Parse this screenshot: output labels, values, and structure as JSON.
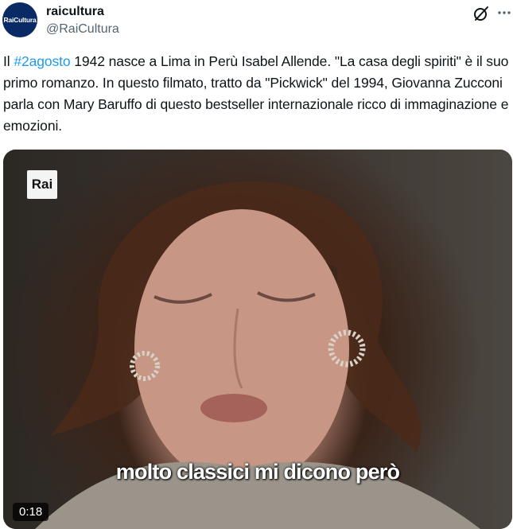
{
  "author": {
    "avatar_text": "RaiCultura",
    "display_name": "raicultura",
    "handle": "@RaiCultura"
  },
  "tweet": {
    "text_before": "Il ",
    "hashtag": "#2agosto",
    "text_after": " 1942 nasce a Lima in Perù Isabel Allende. \"La casa degli spiriti\" è il suo primo romanzo. In questo filmato, tratto da \"Pickwick\" del 1994, Giovanna Zucconi parla con Mary Baruffo di questo bestseller internazionale ricco di immaginazione e emozioni."
  },
  "media": {
    "logo_text": "Rai",
    "subtitle": "molto classici mi dicono però",
    "duration": "0:18"
  },
  "icons": [
    "grok-icon",
    "more-icon"
  ],
  "colors": {
    "link": "#1d9bf0",
    "avatar_bg": "#0a2a66"
  }
}
